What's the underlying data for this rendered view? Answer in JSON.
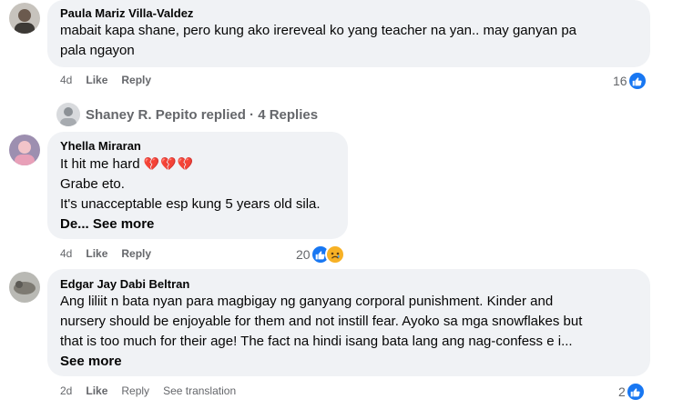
{
  "colors": {
    "link_blue": "#1877f2",
    "meta_gray": "#65676b",
    "bubble_bg": "#f0f2f5",
    "broken_heart": "#e41e3f",
    "sad_yellow": "#f7b125"
  },
  "comment1": {
    "author": "Paula Mariz Villa-Valdez",
    "lines": [
      "mabait kapa shane, pero kung ako irereveal ko yang teacher na yan.. may ganyan pa",
      "pala ngayon"
    ],
    "time": "4d",
    "like": "Like",
    "reply": "Reply",
    "reaction_count": "16",
    "reactions": [
      "like-icon"
    ]
  },
  "replies_summary": {
    "text": "Shaney R. Pepito replied · 4 Replies"
  },
  "comment2": {
    "author": "Yhella Miraran",
    "line1_text": "It hit me hard",
    "line1_emoji": "💔💔💔",
    "line2": "Grabe eto.",
    "line3": "It's unacceptable esp kung 5 years old sila.",
    "line4_prefix": "De...",
    "see_more": "See more",
    "time": "4d",
    "like": "Like",
    "reply": "Reply",
    "reaction_count": "20",
    "reactions": [
      "like-icon",
      "sad-icon"
    ]
  },
  "comment3": {
    "author": "Edgar Jay Dabi Beltran",
    "lines": [
      "Ang liliit n bata nyan para magbigay ng ganyang corporal punishment. Kinder and",
      "nursery should be enjoyable for them and not instill fear. Ayoko sa mga snowflakes but",
      "that is too much for their age! The fact na hindi isang bata lang ang nag-confess e i..."
    ],
    "see_more": "See more",
    "time": "2d",
    "like": "Like",
    "reply": "Reply",
    "see_translation": "See translation",
    "reaction_count": "2",
    "reactions": [
      "like-icon"
    ]
  }
}
